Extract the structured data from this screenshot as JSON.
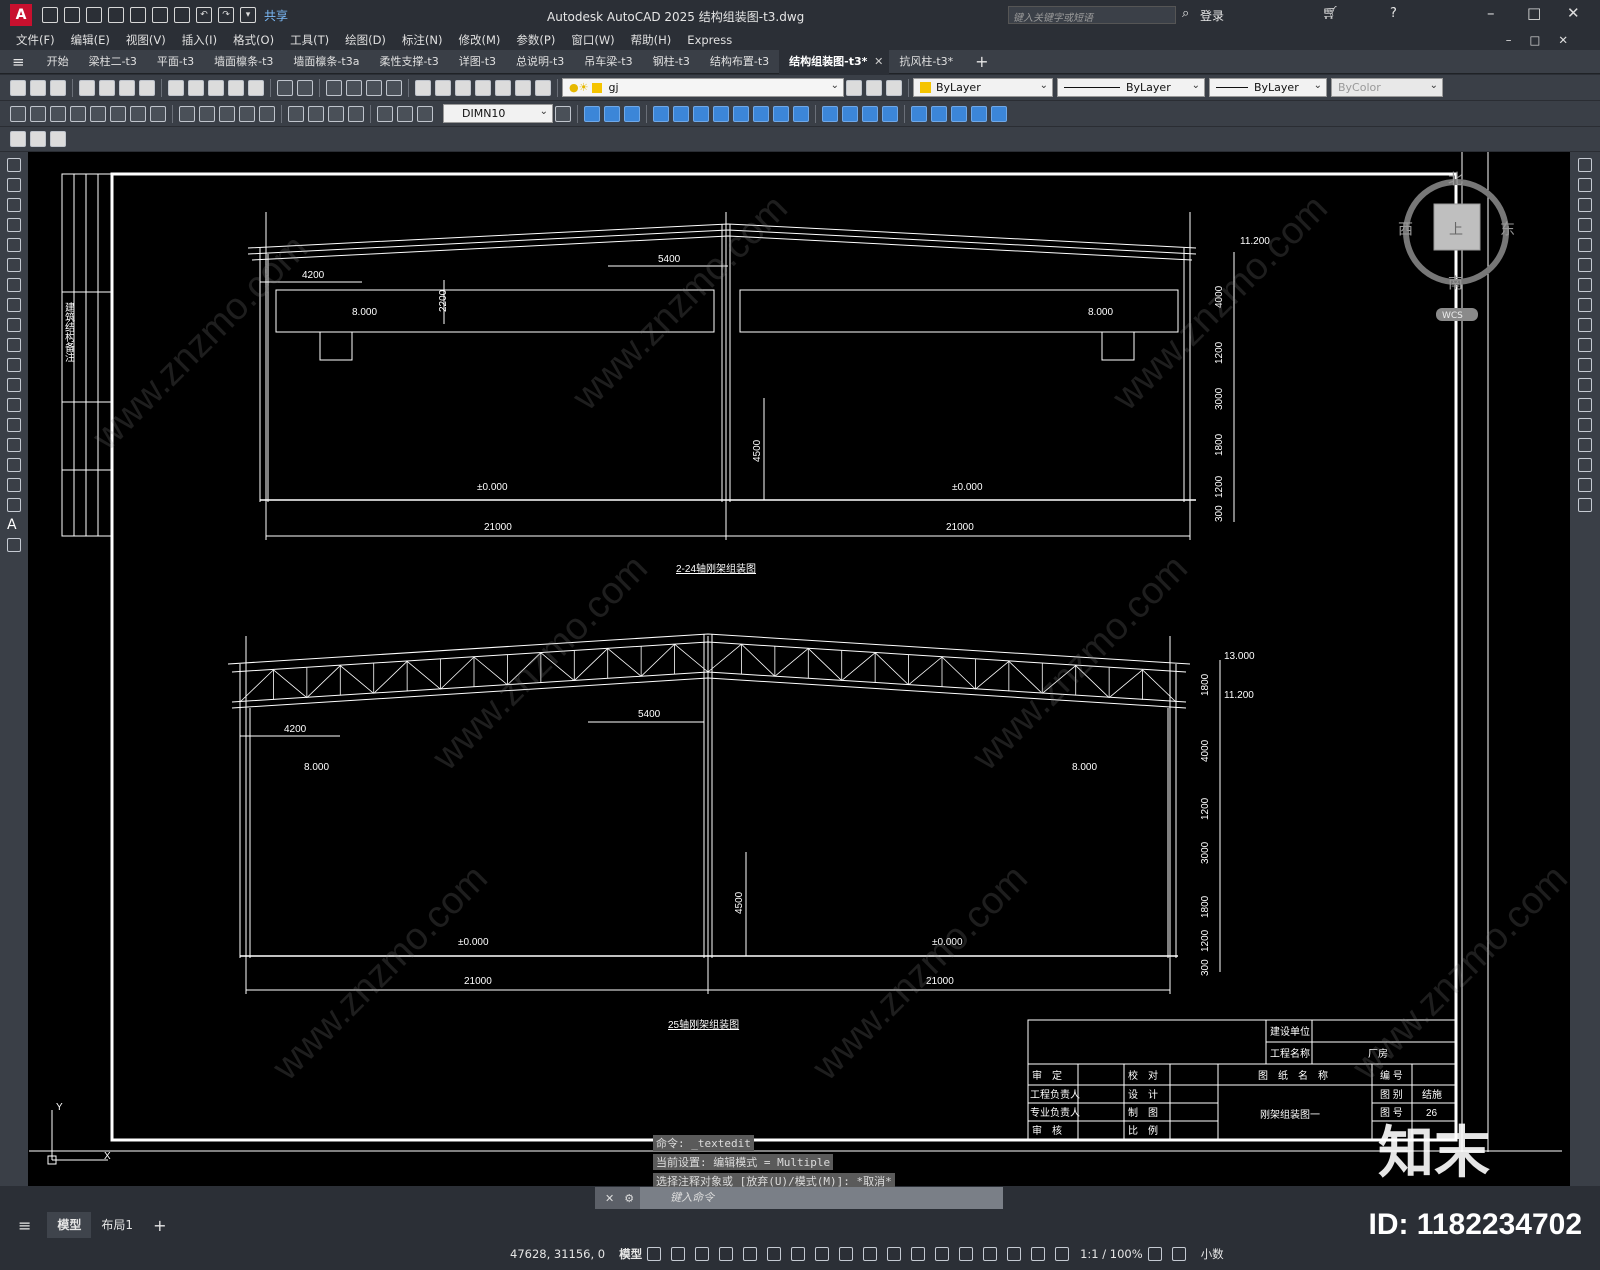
{
  "app": {
    "logo_letter": "A",
    "share": "共享",
    "title": "Autodesk AutoCAD 2025    结构组装图-t3.dwg",
    "search_placeholder": "键入关键字或短语",
    "login": "登录"
  },
  "menu": [
    "文件(F)",
    "编辑(E)",
    "视图(V)",
    "插入(I)",
    "格式(O)",
    "工具(T)",
    "绘图(D)",
    "标注(N)",
    "修改(M)",
    "参数(P)",
    "窗口(W)",
    "帮助(H)",
    "Express"
  ],
  "tabs": [
    "开始",
    "梁柱二-t3",
    "平面-t3",
    "墙面檩条-t3",
    "墙面檩条-t3a",
    "柔性支撑-t3",
    "详图-t3",
    "总说明-t3",
    "吊车梁-t3",
    "钢柱-t3",
    "结构布置-t3",
    "结构组装图-t3*",
    "抗风柱-t3*"
  ],
  "active_tab_index": 11,
  "layer": "gj",
  "props": {
    "color": "ByLayer",
    "linetype": "ByLayer",
    "lineweight": "ByLayer",
    "plotstyle": "ByColor"
  },
  "dimstyle": "DIMN10",
  "viewcube": {
    "north": "北",
    "south": "南",
    "east": "东",
    "west": "西",
    "face": "上",
    "wcs": "WCS"
  },
  "drawing": {
    "frame1_title": "2-24轴刚架组装图",
    "frame2_title": "25轴刚架组装图",
    "span": "21000",
    "dim_4200": "4200",
    "dim_5400": "5400",
    "dim_2200": "2200",
    "dim_4500": "4500",
    "el_crane": "8.000",
    "el_ground": "±0.000",
    "el_1120": "11.200",
    "el_1300": "13.000",
    "vdims1": [
      "4000",
      "1200",
      "3000",
      "1800",
      "1200",
      "300"
    ],
    "vdims2": [
      "1800",
      "4000",
      "1200",
      "3000",
      "1800",
      "1200",
      "300"
    ],
    "titleblock": {
      "client_label": "建设单位",
      "project_label": "工程名称",
      "project_value": "厂房",
      "rows": [
        [
          "审　定",
          "",
          "校　对",
          ""
        ],
        [
          "工程负责人",
          "",
          "设　计",
          ""
        ],
        [
          "专业负责人",
          "",
          "制　图",
          ""
        ],
        [
          "审　核",
          "",
          "比　例",
          ""
        ]
      ],
      "drawing_name_header": "图　纸　名　称",
      "drawing_name": "刚架组装图一",
      "right": [
        [
          "编 号",
          ""
        ],
        [
          "图 别",
          "结施"
        ],
        [
          "图 号",
          "26"
        ]
      ]
    },
    "sidebar_text": "建筑结构备注"
  },
  "command": {
    "history": [
      "命令: _textedit",
      "当前设置: 编辑模式 = Multiple",
      "选择注释对象或 [放弃(U)/模式(M)]: *取消*"
    ],
    "placeholder": "键入命令"
  },
  "layouts": [
    "模型",
    "布局1"
  ],
  "status": {
    "coords": "47628, 31156, 0",
    "model": "模型",
    "scale": "1:1 / 100%",
    "units": "小数"
  },
  "watermark": {
    "site": "www.znzmo.com",
    "brand": "知末网",
    "logo": "知末",
    "id": "ID: 1182234702"
  }
}
